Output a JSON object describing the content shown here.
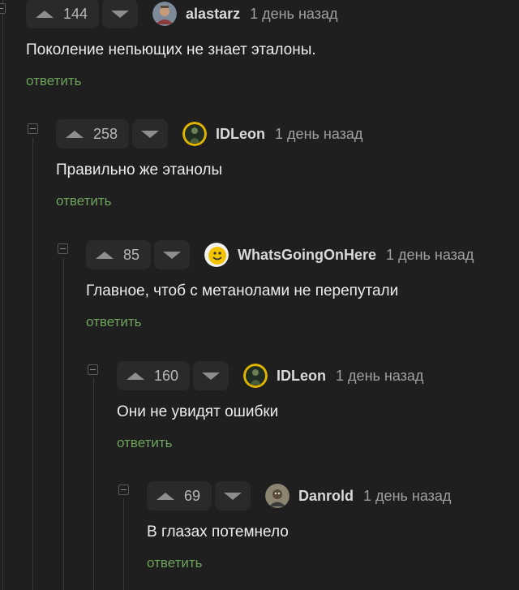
{
  "colors": {
    "background": "#1f1f1f",
    "reply_link": "#6da35b",
    "button_bg": "#2a2a2a"
  },
  "comments": [
    {
      "score": "144",
      "username": "alastarz",
      "time": "1 день назад",
      "text": "Поколение непьющих не знает эталоны.",
      "reply": "ответить",
      "avatar_icon": "avatar-person-icon"
    },
    {
      "score": "258",
      "username": "IDLeon",
      "time": "1 день назад",
      "text": "Правильно же этанолы",
      "reply": "ответить",
      "avatar_icon": "avatar-soldier-icon"
    },
    {
      "score": "85",
      "username": "WhatsGoingOnHere",
      "time": "1 день назад",
      "text": "Главное, чтоб с метанолами не перепутали",
      "reply": "ответить",
      "avatar_icon": "avatar-smiley-icon"
    },
    {
      "score": "160",
      "username": "IDLeon",
      "time": "1 день назад",
      "text": "Они не увидят ошибки",
      "reply": "ответить",
      "avatar_icon": "avatar-soldier-icon"
    },
    {
      "score": "69",
      "username": "Danrold",
      "time": "1 день назад",
      "text": "В глазах потемнело",
      "reply": "ответить",
      "avatar_icon": "avatar-person-icon"
    }
  ]
}
